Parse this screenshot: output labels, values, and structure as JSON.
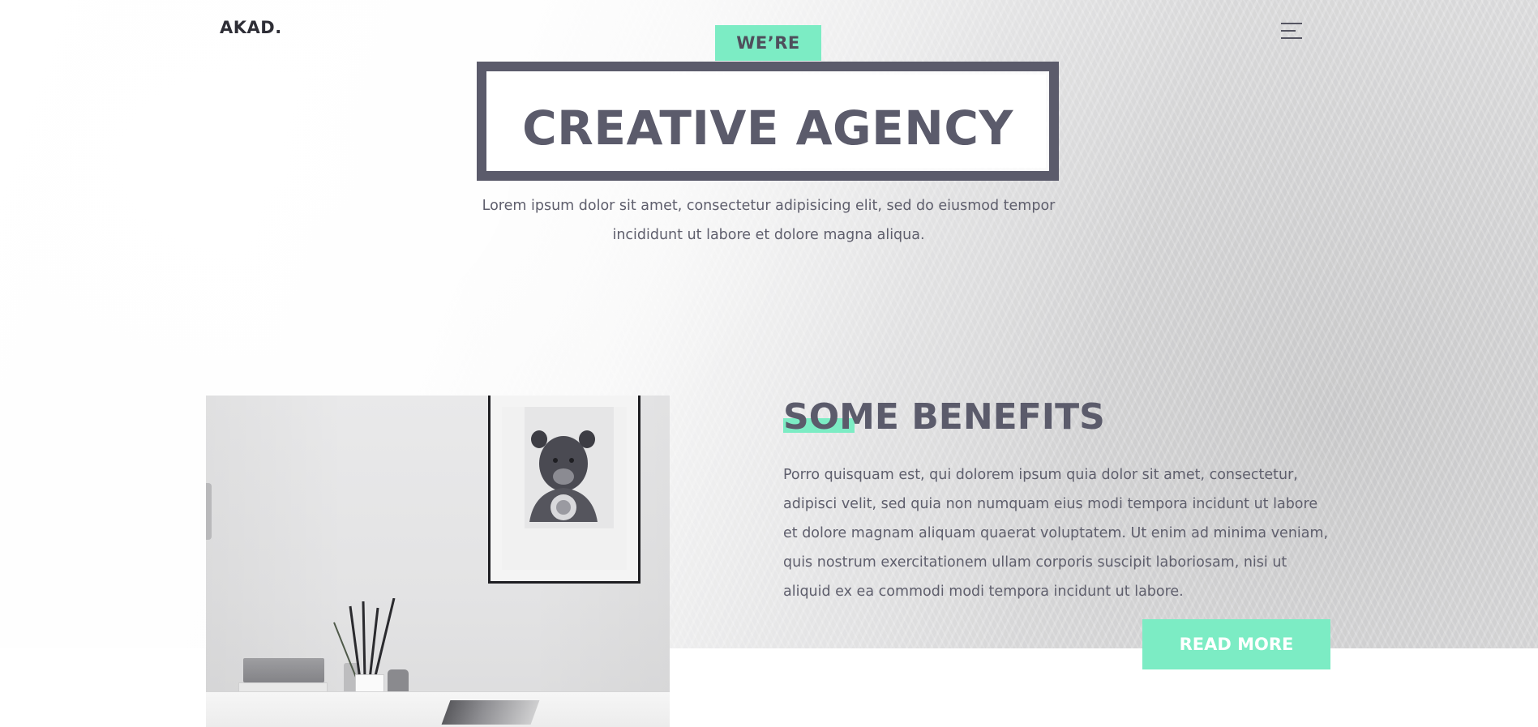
{
  "header": {
    "logo": "AKAD.",
    "menu_icon": "hamburger-menu-icon"
  },
  "hero": {
    "badge": "WE’RE",
    "headline": "CREATIVE AGENCY",
    "subtitle": "Lorem ipsum dolor sit amet, consectetur adipisicing elit, sed do eiusmod tempor incididunt ut labore et dolore magna aliqua."
  },
  "benefits": {
    "title": "SOME BENEFITS",
    "text": "Porro quisquam est, qui dolorem ipsum quia dolor sit amet, consectetur, adipisci velit, sed quia non numquam eius modi tempora incidunt ut labore et dolore magnam aliquam quaerat voluptatem. Ut enim ad minima veniam, quis nostrum exercitationem ullam corporis suscipit laboriosam, nisi ut aliquid ex ea commodi modi tempora incidunt ut labore.",
    "button": "READ MORE"
  },
  "colors": {
    "accent": "#7cecc4",
    "heading": "#5b5b6b",
    "text": "#5e5e6c"
  }
}
